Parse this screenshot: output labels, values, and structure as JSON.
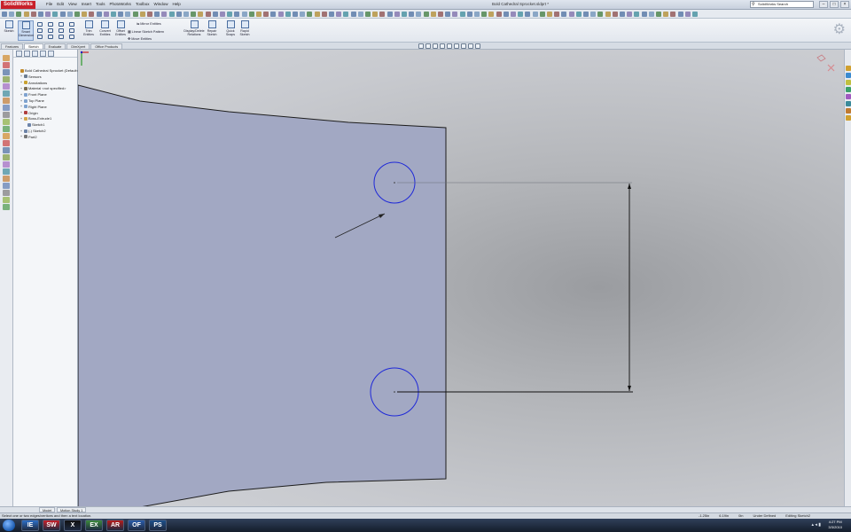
{
  "app": {
    "logo": "SolidWorks",
    "menus": [
      "File",
      "Edit",
      "View",
      "Insert",
      "Tools",
      "PhotoWorks",
      "Toolbox",
      "Window",
      "Help"
    ],
    "document_title": "Bold Cathedral Sprocket.sldprt *",
    "search_placeholder": "SolidWorks Search"
  },
  "ribbon": {
    "buttons": [
      {
        "label": "Sketch"
      },
      {
        "label": "Smart Dimension"
      },
      {
        "label": "Trim Entities"
      },
      {
        "label": "Convert Entities"
      },
      {
        "label": "Offset Entities"
      },
      {
        "label": "Mirror Entities"
      },
      {
        "label": "Linear Sketch Pattern"
      },
      {
        "label": "Move Entities"
      },
      {
        "label": "Display/Delete Relations"
      },
      {
        "label": "Repair Sketch"
      },
      {
        "label": "Quick Snaps"
      },
      {
        "label": "Rapid Sketch"
      }
    ]
  },
  "tabs": [
    "Features",
    "Sketch",
    "Evaluate",
    "DimXpert",
    "Office Products"
  ],
  "tabs_active": 1,
  "tree": {
    "nodes": [
      {
        "label": "Bold Cathedral Sprocket (Default<<Def",
        "color": "#c28a2a",
        "indent": 0
      },
      {
        "label": "Sensors",
        "color": "#6b7c92",
        "indent": 1
      },
      {
        "label": "Annotations",
        "color": "#c9a232",
        "indent": 1
      },
      {
        "label": "Material <not specified>",
        "color": "#7a6d55",
        "indent": 1
      },
      {
        "label": "Front Plane",
        "color": "#7fa3cf",
        "indent": 1
      },
      {
        "label": "Top Plane",
        "color": "#7fa3cf",
        "indent": 1
      },
      {
        "label": "Right Plane",
        "color": "#7fa3cf",
        "indent": 1
      },
      {
        "label": "Origin",
        "color": "#b04040",
        "indent": 1
      },
      {
        "label": "Boss-Extrude1",
        "color": "#d3a64a",
        "indent": 1
      },
      {
        "label": "Sketch1",
        "color": "#6d84a8",
        "indent": 2
      },
      {
        "label": "(-) Sketch2",
        "color": "#6d84a8",
        "indent": 1
      },
      {
        "label": "Part2",
        "color": "#777",
        "indent": 1
      }
    ]
  },
  "model_tabs": [
    "Model",
    "Motion Study 1"
  ],
  "status": {
    "message": "Select one or two edges/vertices and then a text location.",
    "fields": [
      "-1.25in",
      "6.19in",
      "0in",
      "Under Defined",
      "Editing Sketch2"
    ]
  },
  "taskbar": {
    "apps": [
      "IE",
      "SW",
      "X",
      "EX",
      "AR",
      "OF",
      "PS"
    ],
    "time": "4:27 PM",
    "date": "3/3/2010"
  },
  "colors": {
    "part_face": "#a2a8c3",
    "sketch_circle": "#1f29d8",
    "dimension_line": "#1a1a1a"
  }
}
